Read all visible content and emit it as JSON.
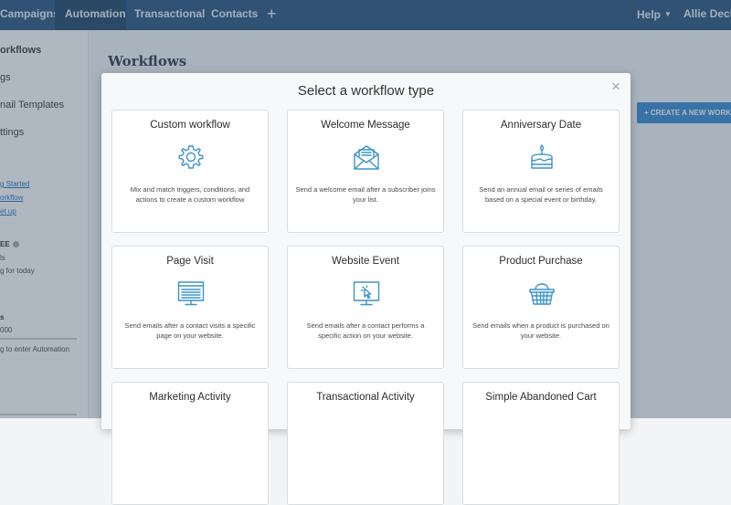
{
  "nav": {
    "tabs": [
      "Campaigns",
      "Automation",
      "Transactional",
      "Contacts"
    ],
    "active": "Automation",
    "add": "+",
    "help": "Help",
    "user": "Allie Decke"
  },
  "sidebar": {
    "items": [
      "orkflows",
      "gs",
      "nail Templates",
      "ttings"
    ],
    "links": [
      "g Started",
      "orkflow",
      "et up"
    ],
    "heading1": "EE",
    "line1": "ls",
    "line2": "g for today",
    "heading2": "s",
    "line3": "000",
    "line4": "g to enter Automation"
  },
  "page": {
    "title": "Workflows",
    "create_button": "+ CREATE A NEW WORKF"
  },
  "modal": {
    "title": "Select a workflow type",
    "close": "×",
    "cards": [
      {
        "title": "Custom workflow",
        "icon": "gear-icon",
        "desc": "Mix and match triggers, conditions, and actions to create a custom workflow"
      },
      {
        "title": "Welcome Message",
        "icon": "envelope-icon",
        "desc": "Send a welcome email after a subscriber joins your list."
      },
      {
        "title": "Anniversary Date",
        "icon": "cake-icon",
        "desc": "Send an annual email or series of emails based on a special event or birthday."
      },
      {
        "title": "Page Visit",
        "icon": "webpage-icon",
        "desc": "Send emails after a contact visits a specific page on your website."
      },
      {
        "title": "Website Event",
        "icon": "monitor-cursor-icon",
        "desc": "Send emails after a contact performs a specific action on your website."
      },
      {
        "title": "Product Purchase",
        "icon": "basket-icon",
        "desc": "Send emails when a product is purchased on your website."
      },
      {
        "title": "Marketing Activity",
        "icon": "",
        "desc": ""
      },
      {
        "title": "Transactional Activity",
        "icon": "",
        "desc": ""
      },
      {
        "title": "Simple Abandoned Cart",
        "icon": "",
        "desc": ""
      }
    ]
  },
  "colors": {
    "nav": "#1f4f7a",
    "accent": "#2f86cf",
    "icon": "#3d94c9"
  }
}
